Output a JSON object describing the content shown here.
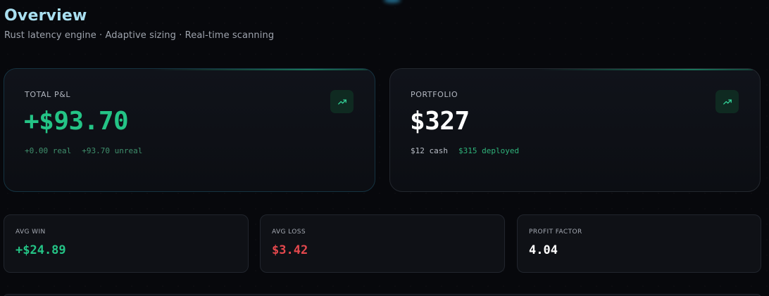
{
  "header": {
    "title": "Overview",
    "subtitle": "Rust latency engine · Adaptive sizing · Real-time scanning"
  },
  "cards": {
    "pnl": {
      "label": "TOTAL P&L",
      "value": "+$93.70",
      "realized": "+0.00 real",
      "unrealized": "+93.70 unreal",
      "icon": "trending-up-icon"
    },
    "portfolio": {
      "label": "PORTFOLIO",
      "value": "$327",
      "cash": "$12 cash",
      "deployed": "$315 deployed",
      "icon": "trending-up-icon"
    }
  },
  "stats": {
    "avg_win": {
      "label": "AVG WIN",
      "value": "+$24.89"
    },
    "avg_loss": {
      "label": "AVG LOSS",
      "value": "$3.42"
    },
    "profit_factor": {
      "label": "PROFIT FACTOR",
      "value": "4.04"
    }
  },
  "colors": {
    "accent_green": "#24c486",
    "loss_red": "#e5484d",
    "title": "#a9dff0",
    "background": "#07080c"
  }
}
